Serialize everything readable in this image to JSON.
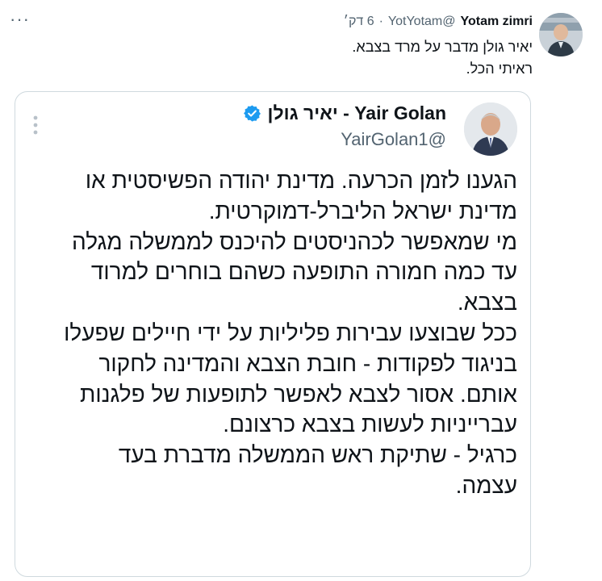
{
  "outer_tweet": {
    "display_name": "Yotam zimri",
    "handle": "@YotYotam",
    "separator": "·",
    "time": "6 דק׳",
    "lines": [
      "יאיר גולן מדבר על מרד בצבא.",
      "ראיתי הכל."
    ]
  },
  "quoted_tweet": {
    "display_name": "Yair Golan - יאיר גולן",
    "handle": "@YairGolan1",
    "verified": true,
    "lines": [
      "הגענו לזמן הכרעה. מדינת יהודה הפשיסטית או",
      "מדינת ישראל הליברל-דמוקרטית.",
      "מי שמאפשר לכהניסטים להיכנס לממשלה מגלה",
      "עד כמה חמורה התופעה כשהם בוחרים למרוד",
      "בצבא.",
      "ככל שבוצעו עבירות פליליות על ידי חיילים שפעלו",
      "בניגוד לפקודות - חובת הצבא והמדינה לחקור",
      "אותם. אסור לצבא לאפשר לתופעות של פלגנות",
      "עברייניות לעשות בצבא כרצונם.",
      "כרגיל - שתיקת ראש הממשלה מדברת בעד",
      "עצמה."
    ]
  },
  "colors": {
    "text": "#0f1419",
    "secondary": "#536471",
    "verified_blue": "#1d9bf0",
    "card_border": "#cfd9de"
  }
}
